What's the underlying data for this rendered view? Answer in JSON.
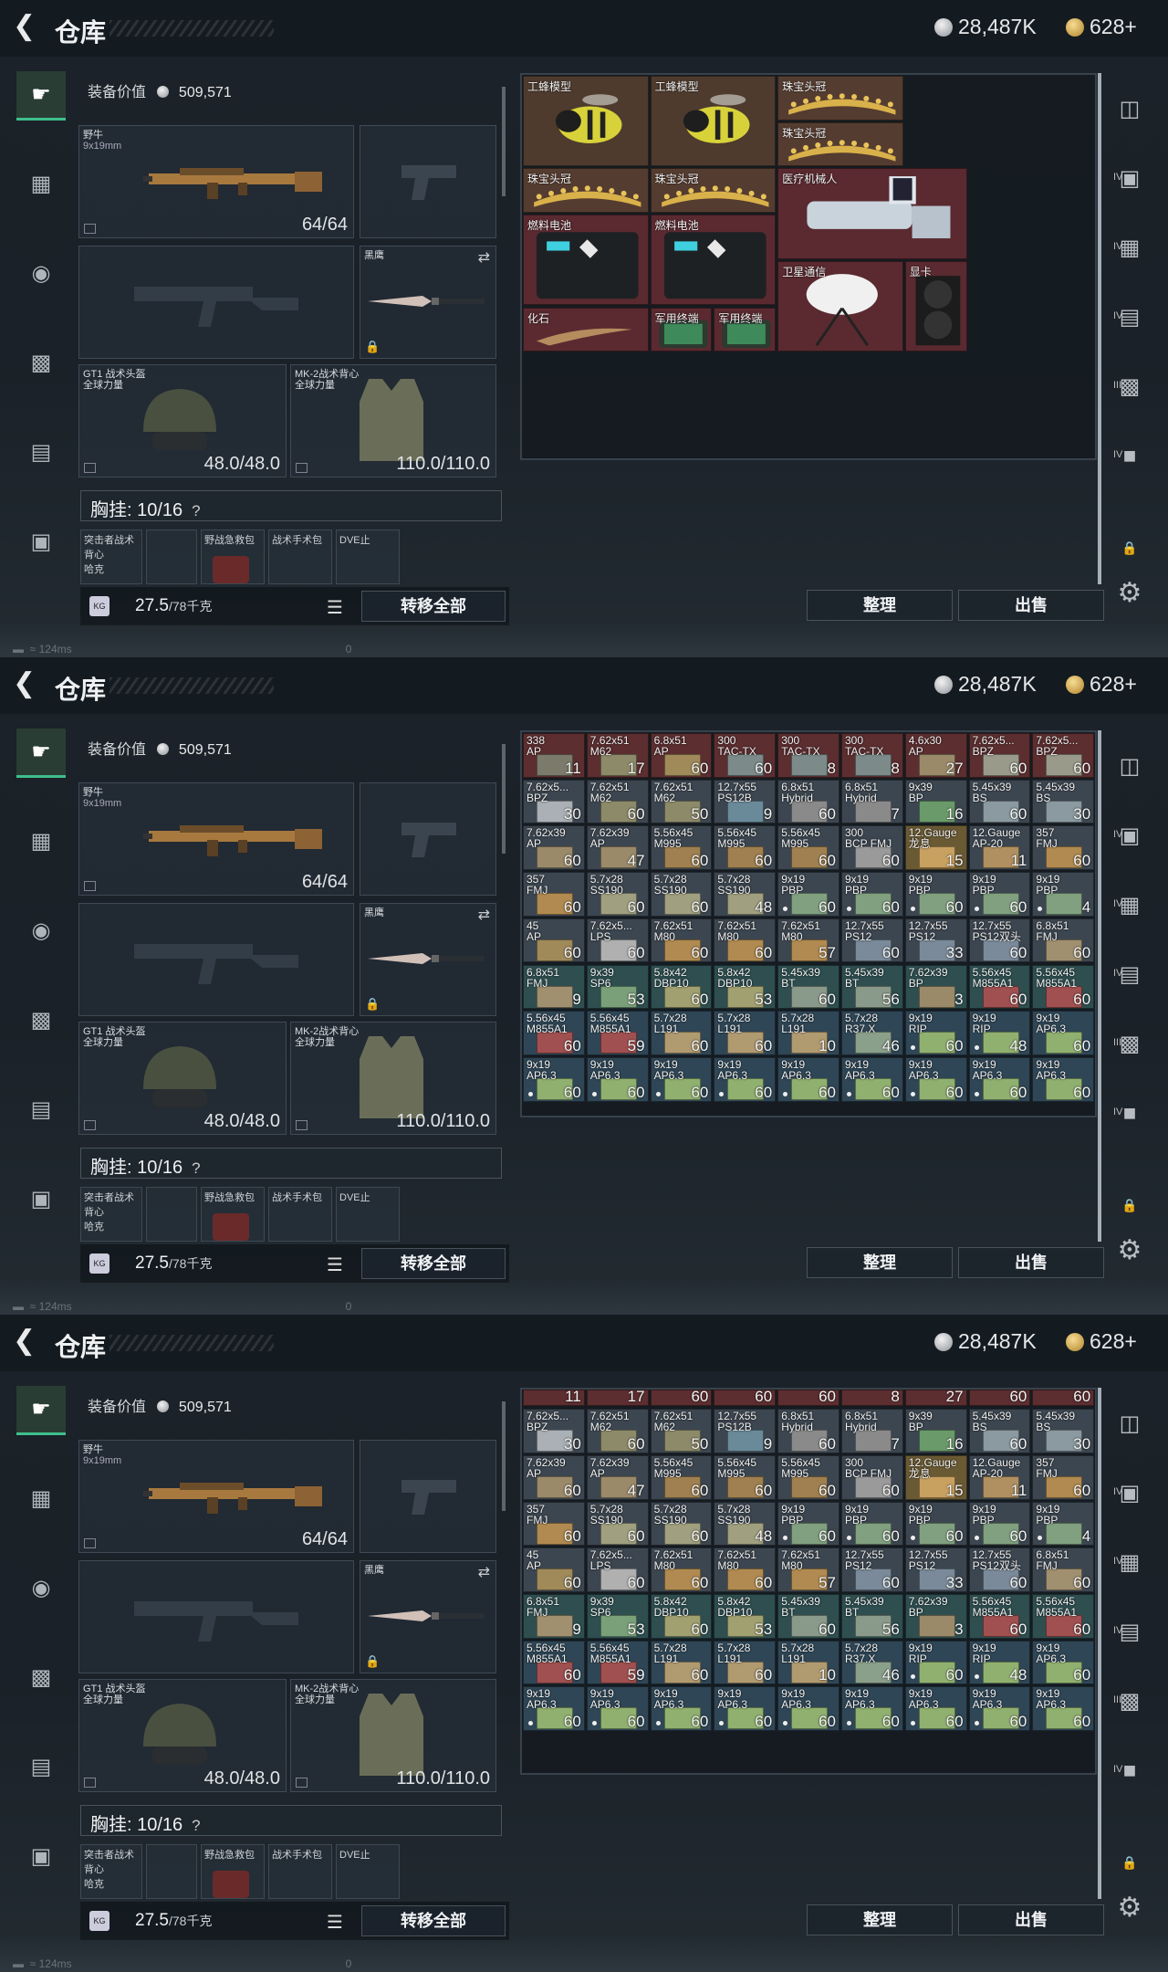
{
  "header": {
    "title": "仓库",
    "silver": "28,487K",
    "gold": "628+"
  },
  "loadout": {
    "equip_value_label": "装备价值",
    "equip_value": "509,571",
    "primary_name": "野牛",
    "primary_caliber": "9x19mm",
    "primary_ammo": "64/64",
    "melee_name": "黑鹰",
    "helmet_name": "GT1 战术头盔",
    "helmet_sub": "全球力量",
    "helmet_dur": "48.0/48.0",
    "armor_name": "MK-2战术背心",
    "armor_sub": "全球力量",
    "armor_dur": "110.0/110.0",
    "rig_label": "胸挂: 10/16",
    "rig_q": "?",
    "pouch1": "突击者战术背心",
    "pouch1_sub": "哈克",
    "pouch2": "野战急救包",
    "pouch3": "战术手术包",
    "pouch4": "DVE止",
    "weight": "27.5",
    "weight_max": "/78千克",
    "kg_badge": "KG",
    "transfer_all": "转移全部"
  },
  "buttons": {
    "sort": "整理",
    "sell": "出售"
  },
  "status": {
    "ping": "124ms",
    "zero": "0"
  },
  "stash_valuables": [
    {
      "name": "工蜂模型",
      "x": 0,
      "y": 0,
      "w": 2,
      "h": 2,
      "color": "#4e3b2e",
      "kind": "bee"
    },
    {
      "name": "工蜂模型",
      "x": 2,
      "y": 0,
      "w": 2,
      "h": 2,
      "color": "#4e3b2e",
      "kind": "bee"
    },
    {
      "name": "珠宝头冠",
      "x": 4,
      "y": 0,
      "w": 2,
      "h": 1,
      "color": "#553c30",
      "kind": "crown"
    },
    {
      "name": "珠宝头冠",
      "x": 4,
      "y": 1,
      "w": 2,
      "h": 1,
      "color": "#553c30",
      "kind": "crown"
    },
    {
      "name": "珠宝头冠",
      "x": 0,
      "y": 2,
      "w": 2,
      "h": 1,
      "color": "#553c30",
      "kind": "crown"
    },
    {
      "name": "珠宝头冠",
      "x": 2,
      "y": 2,
      "w": 2,
      "h": 1,
      "color": "#553c30",
      "kind": "crown"
    },
    {
      "name": "医疗机械人",
      "x": 4,
      "y": 2,
      "w": 3,
      "h": 2,
      "color": "#5a2a30",
      "kind": "robot"
    },
    {
      "name": "燃料电池",
      "x": 0,
      "y": 3,
      "w": 2,
      "h": 2,
      "color": "#5a2a30",
      "kind": "battery"
    },
    {
      "name": "燃料电池",
      "x": 2,
      "y": 3,
      "w": 2,
      "h": 2,
      "color": "#5a2a30",
      "kind": "battery"
    },
    {
      "name": "卫星通信",
      "x": 4,
      "y": 4,
      "w": 2,
      "h": 2,
      "color": "#5a2a30",
      "kind": "dish"
    },
    {
      "name": "显卡",
      "x": 6,
      "y": 4,
      "w": 1,
      "h": 2,
      "color": "#5a2a30",
      "kind": "gpu"
    },
    {
      "name": "化石",
      "x": 0,
      "y": 5,
      "w": 2,
      "h": 1,
      "color": "#5a2a30",
      "kind": "fossil"
    },
    {
      "name": "军用终端",
      "x": 2,
      "y": 5,
      "w": 1,
      "h": 1,
      "color": "#5a2a30",
      "kind": "tablet"
    },
    {
      "name": "军用终端",
      "x": 3,
      "y": 5,
      "w": 1,
      "h": 1,
      "color": "#5a2a30",
      "kind": "tablet"
    }
  ],
  "ammo_colors": {
    "red": "#5c2e30",
    "gray": "#3c4650",
    "blue": "#2f4656",
    "green": "#37503a",
    "gold": "#6a5a34",
    "teal": "#2e4e50"
  },
  "ammo_rows": [
    [
      {
        "n1": "338",
        "n2": "AP",
        "q": "11",
        "c": "red",
        "b": "#7c7a6a"
      },
      {
        "n1": "7.62x51",
        "n2": "M62",
        "q": "17",
        "c": "red",
        "b": "#8d8a6a"
      },
      {
        "n1": "6.8x51",
        "n2": "AP",
        "q": "60",
        "c": "red",
        "b": "#a08a5a"
      },
      {
        "n1": "300",
        "n2": "TAC-TX",
        "q": "60",
        "c": "red",
        "b": "#7c8a8a"
      },
      {
        "n1": "300",
        "n2": "TAC-TX",
        "q": "8",
        "c": "red",
        "b": "#7c8a8a"
      },
      {
        "n1": "300",
        "n2": "TAC-TX",
        "q": "8",
        "c": "red",
        "b": "#7c8a8a"
      },
      {
        "n1": "4.6x30",
        "n2": "AP",
        "q": "27",
        "c": "red",
        "b": "#9a8a6a"
      },
      {
        "n1": "7.62x5...",
        "n2": "BPZ",
        "q": "60",
        "c": "red",
        "b": "#9a9a8a"
      },
      {
        "n1": "7.62x5...",
        "n2": "BPZ",
        "q": "60",
        "c": "red",
        "b": "#9a9a8a"
      }
    ],
    [
      {
        "n1": "7.62x5...",
        "n2": "BPZ",
        "q": "30",
        "c": "gray",
        "b": "#aab0b5"
      },
      {
        "n1": "7.62x51",
        "n2": "M62",
        "q": "60",
        "c": "gray",
        "b": "#8d8a6a"
      },
      {
        "n1": "7.62x51",
        "n2": "M62",
        "q": "50",
        "c": "gray",
        "b": "#8d8a6a"
      },
      {
        "n1": "12.7x55",
        "n2": "PS12B",
        "q": "9",
        "c": "gray",
        "b": "#6a8a9a"
      },
      {
        "n1": "6.8x51",
        "n2": "Hybrid",
        "q": "60",
        "c": "gray",
        "b": "#8a8a8a"
      },
      {
        "n1": "6.8x51",
        "n2": "Hybrid",
        "q": "7",
        "c": "gray",
        "b": "#8a8a8a"
      },
      {
        "n1": "9x39",
        "n2": "BP",
        "q": "16",
        "c": "gray",
        "b": "#6a9a6a"
      },
      {
        "n1": "5.45x39",
        "n2": "BS",
        "q": "60",
        "c": "gray",
        "b": "#8a9aa0"
      },
      {
        "n1": "5.45x39",
        "n2": "BS",
        "q": "30",
        "c": "gray",
        "b": "#8a9aa0"
      }
    ],
    [
      {
        "n1": "7.62x39",
        "n2": "AP",
        "q": "60",
        "c": "gray",
        "b": "#9a8a6a"
      },
      {
        "n1": "7.62x39",
        "n2": "AP",
        "q": "47",
        "c": "gray",
        "b": "#9a8a6a"
      },
      {
        "n1": "5.56x45",
        "n2": "M995",
        "q": "60",
        "c": "gray",
        "b": "#a08050"
      },
      {
        "n1": "5.56x45",
        "n2": "M995",
        "q": "60",
        "c": "gray",
        "b": "#a08050"
      },
      {
        "n1": "5.56x45",
        "n2": "M995",
        "q": "60",
        "c": "gray",
        "b": "#a08050"
      },
      {
        "n1": "300",
        "n2": "BCP FMJ",
        "q": "60",
        "c": "gray",
        "b": "#9a9a9a"
      },
      {
        "n1": "12.Gauge",
        "n2": "龙息",
        "q": "15",
        "c": "gold",
        "b": "#c8a060"
      },
      {
        "n1": "12.Gauge",
        "n2": "AP-20",
        "q": "11",
        "c": "gray",
        "b": "#b09060"
      },
      {
        "n1": "357",
        "n2": "FMJ",
        "q": "60",
        "c": "gray",
        "b": "#b08a50"
      }
    ],
    [
      {
        "n1": "357",
        "n2": "FMJ",
        "q": "60",
        "c": "gray",
        "b": "#b08a50"
      },
      {
        "n1": "5.7x28",
        "n2": "SS190",
        "q": "60",
        "c": "gray",
        "b": "#a0a080"
      },
      {
        "n1": "5.7x28",
        "n2": "SS190",
        "q": "60",
        "c": "gray",
        "b": "#a0a080"
      },
      {
        "n1": "5.7x28",
        "n2": "SS190",
        "q": "48",
        "c": "gray",
        "b": "#a0a080"
      },
      {
        "n1": "9x19",
        "n2": "PBP",
        "q": "60",
        "c": "gray",
        "b": "#80a080",
        "d": true
      },
      {
        "n1": "9x19",
        "n2": "PBP",
        "q": "60",
        "c": "gray",
        "b": "#80a080",
        "d": true
      },
      {
        "n1": "9x19",
        "n2": "PBP",
        "q": "60",
        "c": "gray",
        "b": "#80a080",
        "d": true
      },
      {
        "n1": "9x19",
        "n2": "PBP",
        "q": "60",
        "c": "gray",
        "b": "#80a080",
        "d": true
      },
      {
        "n1": "9x19",
        "n2": "PBP",
        "q": "4",
        "c": "gray",
        "b": "#80a080",
        "d": true
      }
    ],
    [
      {
        "n1": "45",
        "n2": "AP",
        "q": "60",
        "c": "gray",
        "b": "#a08a5a"
      },
      {
        "n1": "7.62x5...",
        "n2": "LPS",
        "q": "60",
        "c": "gray",
        "b": "#b0b0b0"
      },
      {
        "n1": "7.62x51",
        "n2": "M80",
        "q": "60",
        "c": "gray",
        "b": "#b08a50"
      },
      {
        "n1": "7.62x51",
        "n2": "M80",
        "q": "60",
        "c": "gray",
        "b": "#b08a50"
      },
      {
        "n1": "7.62x51",
        "n2": "M80",
        "q": "57",
        "c": "gray",
        "b": "#b08a50"
      },
      {
        "n1": "12.7x55",
        "n2": "PS12",
        "q": "60",
        "c": "gray",
        "b": "#7a8a9a"
      },
      {
        "n1": "12.7x55",
        "n2": "PS12",
        "q": "33",
        "c": "gray",
        "b": "#7a8a9a"
      },
      {
        "n1": "12.7x55",
        "n2": "PS12双头",
        "q": "60",
        "c": "gray",
        "b": "#7a8a9a"
      },
      {
        "n1": "6.8x51",
        "n2": "FMJ",
        "q": "60",
        "c": "gray",
        "b": "#a09070"
      }
    ],
    [
      {
        "n1": "6.8x51",
        "n2": "FMJ",
        "q": "9",
        "c": "teal",
        "b": "#a09070"
      },
      {
        "n1": "9x39",
        "n2": "SP6",
        "q": "53",
        "c": "teal",
        "b": "#7aa07a"
      },
      {
        "n1": "5.8x42",
        "n2": "DBP10",
        "q": "60",
        "c": "teal",
        "b": "#a0a070"
      },
      {
        "n1": "5.8x42",
        "n2": "DBP10",
        "q": "53",
        "c": "teal",
        "b": "#a0a070"
      },
      {
        "n1": "5.45x39",
        "n2": "BT",
        "q": "60",
        "c": "teal",
        "b": "#8a9a8a"
      },
      {
        "n1": "5.45x39",
        "n2": "BT",
        "q": "56",
        "c": "teal",
        "b": "#8a9a8a"
      },
      {
        "n1": "7.62x39",
        "n2": "BP",
        "q": "3",
        "c": "teal",
        "b": "#9a8a6a"
      },
      {
        "n1": "5.56x45",
        "n2": "M855A1",
        "q": "60",
        "c": "teal",
        "b": "#a05050"
      },
      {
        "n1": "5.56x45",
        "n2": "M855A1",
        "q": "60",
        "c": "teal",
        "b": "#a05050"
      }
    ],
    [
      {
        "n1": "5.56x45",
        "n2": "M855A1",
        "q": "60",
        "c": "blue",
        "b": "#a05050"
      },
      {
        "n1": "5.56x45",
        "n2": "M855A1",
        "q": "59",
        "c": "blue",
        "b": "#a05050"
      },
      {
        "n1": "5.7x28",
        "n2": "L191",
        "q": "60",
        "c": "blue",
        "b": "#b09a70"
      },
      {
        "n1": "5.7x28",
        "n2": "L191",
        "q": "60",
        "c": "blue",
        "b": "#b09a70"
      },
      {
        "n1": "5.7x28",
        "n2": "L191",
        "q": "10",
        "c": "blue",
        "b": "#b09a70"
      },
      {
        "n1": "5.7x28",
        "n2": "R37.X",
        "q": "46",
        "c": "blue",
        "b": "#8aa08a"
      },
      {
        "n1": "9x19",
        "n2": "RIP",
        "q": "60",
        "c": "blue",
        "b": "#90b070",
        "d": true
      },
      {
        "n1": "9x19",
        "n2": "RIP",
        "q": "48",
        "c": "blue",
        "b": "#90b070",
        "d": true
      },
      {
        "n1": "9x19",
        "n2": "AP6.3",
        "q": "60",
        "c": "blue",
        "b": "#90b070"
      }
    ],
    [
      {
        "n1": "9x19",
        "n2": "AP6.3",
        "q": "60",
        "c": "blue",
        "b": "#90b070",
        "d": true
      },
      {
        "n1": "9x19",
        "n2": "AP6.3",
        "q": "60",
        "c": "blue",
        "b": "#90b070",
        "d": true
      },
      {
        "n1": "9x19",
        "n2": "AP6.3",
        "q": "60",
        "c": "blue",
        "b": "#90b070",
        "d": true
      },
      {
        "n1": "9x19",
        "n2": "AP6.3",
        "q": "60",
        "c": "blue",
        "b": "#90b070",
        "d": true
      },
      {
        "n1": "9x19",
        "n2": "AP6.3",
        "q": "60",
        "c": "blue",
        "b": "#90b070",
        "d": true
      },
      {
        "n1": "9x19",
        "n2": "AP6.3",
        "q": "60",
        "c": "blue",
        "b": "#90b070",
        "d": true
      },
      {
        "n1": "9x19",
        "n2": "AP6.3",
        "q": "60",
        "c": "blue",
        "b": "#90b070",
        "d": true
      },
      {
        "n1": "9x19",
        "n2": "AP6.3",
        "q": "60",
        "c": "blue",
        "b": "#90b070",
        "d": true
      },
      {
        "n1": "9x19",
        "n2": "AP6.3",
        "q": "60",
        "c": "blue",
        "b": "#90b070"
      }
    ]
  ],
  "panel3_top_qty": [
    "11",
    "17",
    "60",
    "60",
    "60",
    "8",
    "27",
    "60",
    "60"
  ],
  "icons": {
    "left_nav": [
      "pistol-icon",
      "vest-icon",
      "helmet-icon",
      "backpack-icon",
      "pouch-icon",
      "toolbox-icon"
    ],
    "right_nav": [
      "storage-icon",
      "container-tier4-icon",
      "container-tier4-icon",
      "container-tier4-icon",
      "ammo-shelf-icon",
      "container-tier4-icon",
      "lock-icon",
      "gear-icon"
    ]
  }
}
